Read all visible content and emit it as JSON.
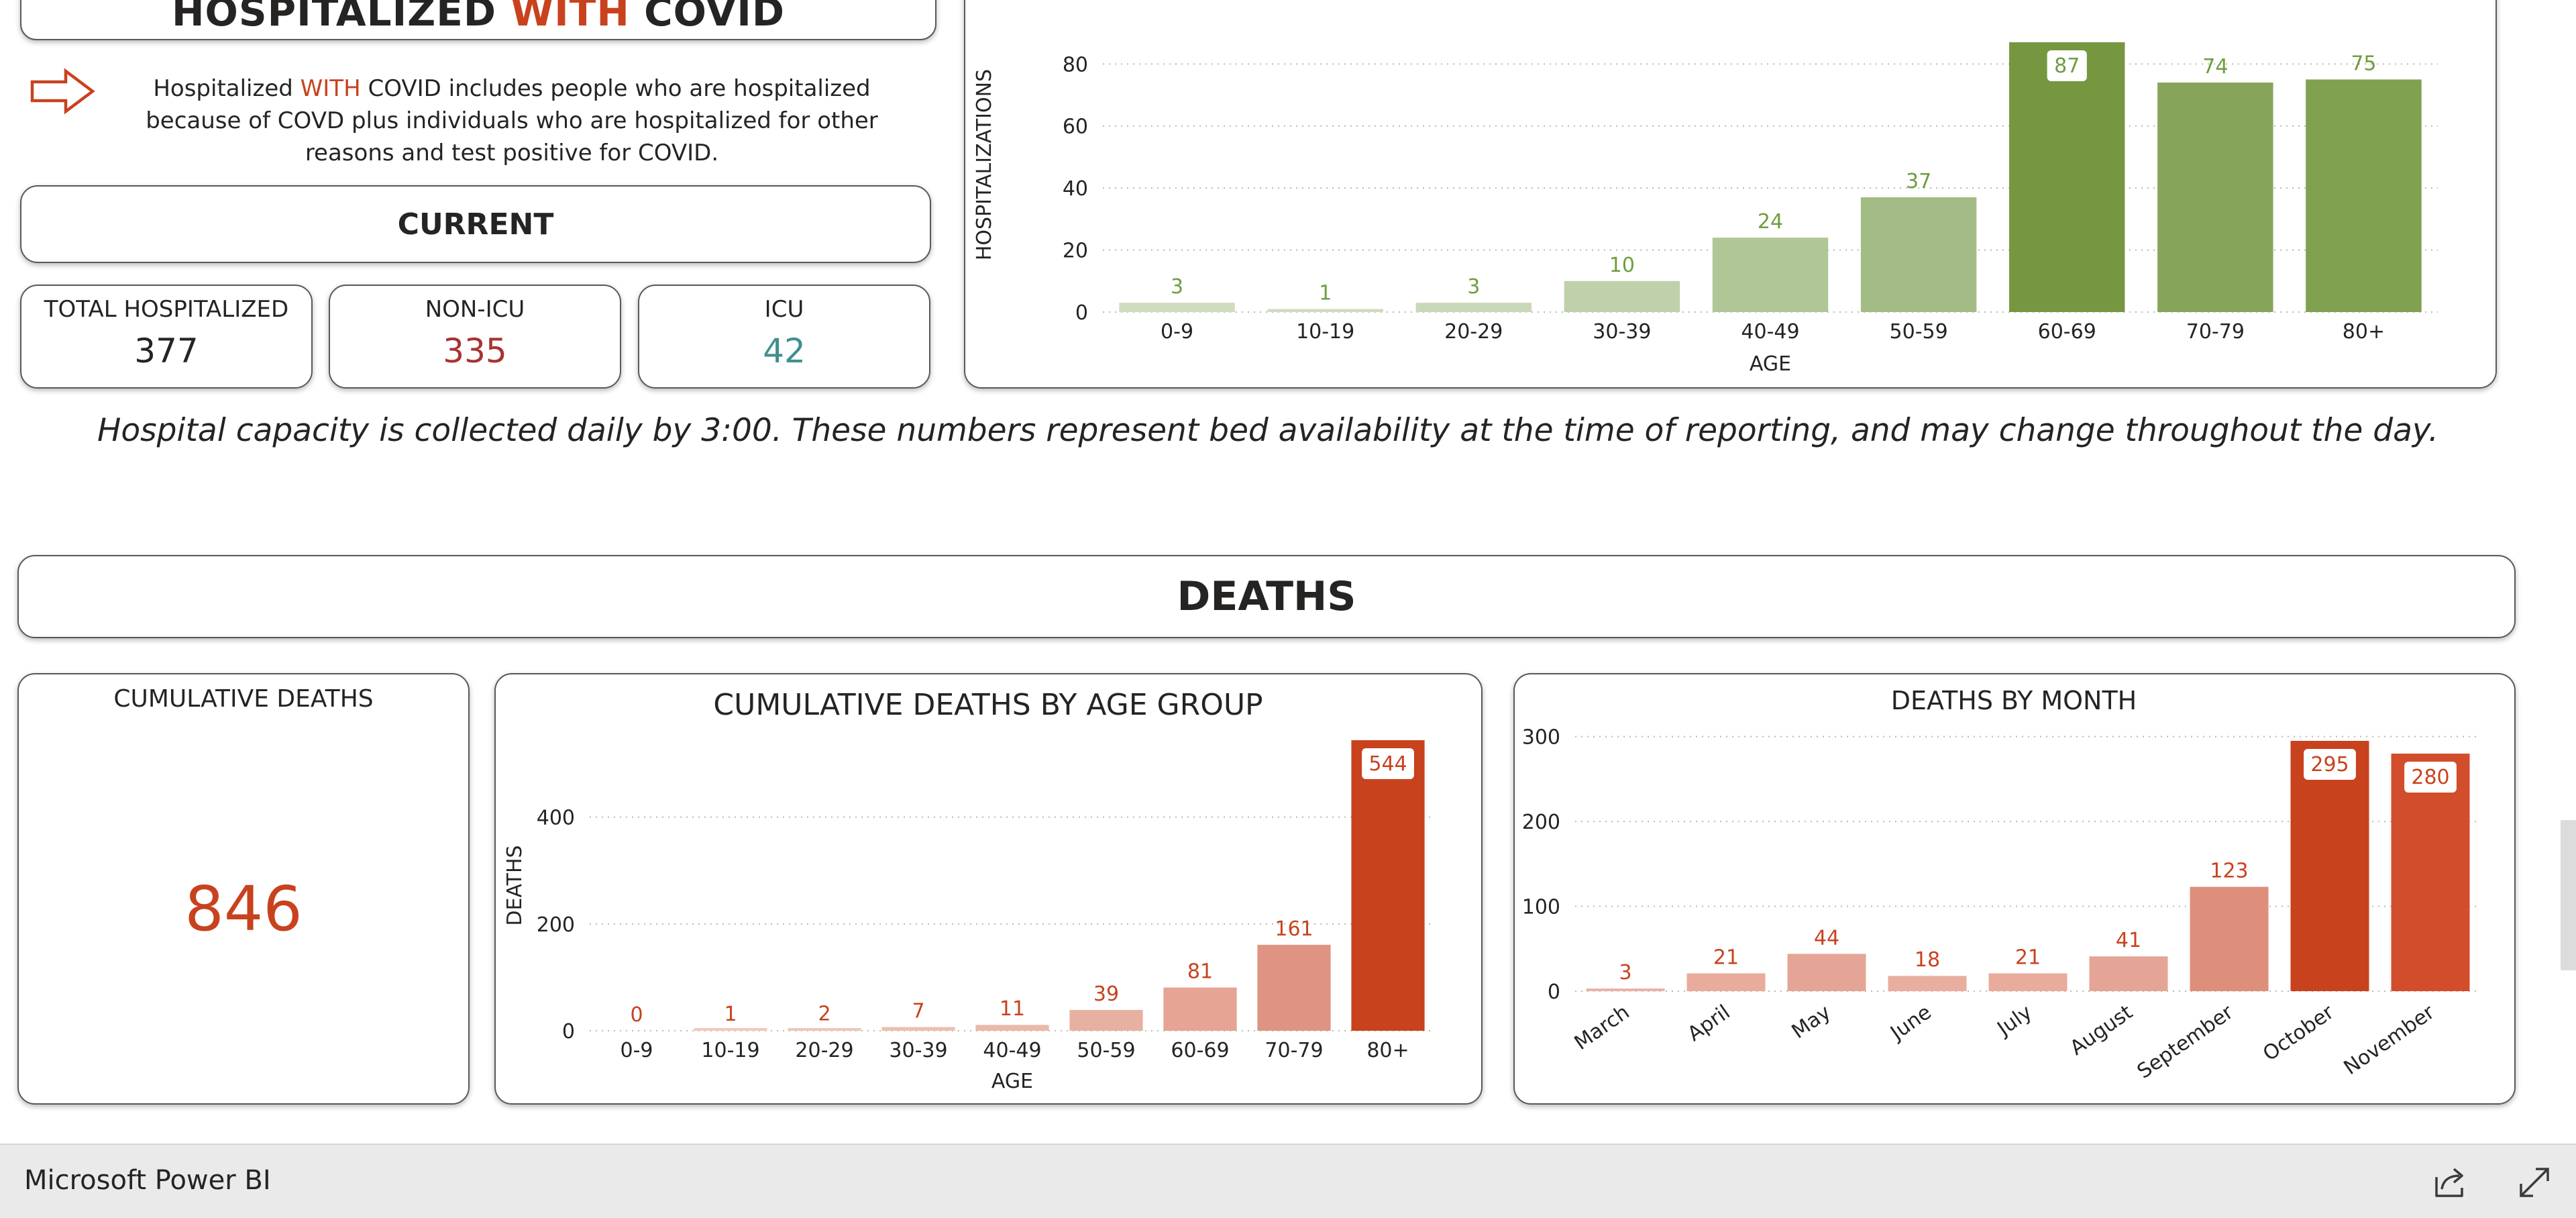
{
  "hosp_header": {
    "part1": "HOSPITALIZED ",
    "part2": "WITH",
    "part3": " COVID"
  },
  "note": {
    "part1": "Hospitalized ",
    "part2": "WITH",
    "part3": " COVID includes people who are hospitalized because of COVD plus individuals who are hospitalized for other reasons and test positive for COVID."
  },
  "current_header": "CURRENT",
  "kpis": {
    "total_hospitalized": {
      "label": "TOTAL HOSPITALIZED",
      "value": "377"
    },
    "non_icu": {
      "label": "NON-ICU",
      "value": "335"
    },
    "icu": {
      "label": "ICU",
      "value": "42"
    }
  },
  "capacity_note": "Hospital capacity is collected daily by 3:00. These numbers represent bed availability at the time of reporting, and may change throughout the day.",
  "deaths_header": "DEATHS",
  "cumulative_deaths": {
    "title": "CUMULATIVE DEATHS",
    "value": "846"
  },
  "footer": {
    "brand": "Microsoft Power BI"
  },
  "colors": {
    "orange": "#c8421e",
    "green_text": "#6f9d40",
    "teal": "#3f8f8f",
    "dark_red": "#a83232"
  },
  "icons": {
    "note": "arrow-right-outline-icon",
    "share": "share-icon",
    "fullscreen": "expand-icon"
  },
  "chart_data": [
    {
      "id": "hospitalizations_by_age",
      "type": "bar",
      "title": "",
      "xlabel": "AGE",
      "ylabel": "HOSPITALIZATIONS",
      "categories": [
        "0-9",
        "10-19",
        "20-29",
        "30-39",
        "40-49",
        "50-59",
        "60-69",
        "70-79",
        "80+"
      ],
      "values": [
        3,
        1,
        3,
        10,
        24,
        37,
        87,
        74,
        75
      ],
      "ylim": [
        0,
        95
      ],
      "yticks": [
        0,
        20,
        40,
        60,
        80
      ],
      "grid": true,
      "colors": [
        "#cfdcc0",
        "#cfdcc0",
        "#cad8ba",
        "#bfd0ab",
        "#b1c697",
        "#a3bc85",
        "#76973f",
        "#86a55a",
        "#7fa150"
      ],
      "label_color": "#6f9d40",
      "boxed_label": "60-69"
    },
    {
      "id": "cumulative_deaths_by_age",
      "type": "bar",
      "title": "CUMULATIVE DEATHS BY AGE GROUP",
      "xlabel": "AGE",
      "ylabel": "DEATHS",
      "categories": [
        "0-9",
        "10-19",
        "20-29",
        "30-39",
        "40-49",
        "50-59",
        "60-69",
        "70-79",
        "80+"
      ],
      "values": [
        0,
        1,
        2,
        7,
        11,
        39,
        81,
        161,
        544
      ],
      "ylim": [
        0,
        544
      ],
      "yticks": [
        0,
        200,
        400
      ],
      "grid": true,
      "colors": [
        "#f0c9bd",
        "#f0c9bd",
        "#efc6b9",
        "#edbfb1",
        "#ebb9a9",
        "#e8b0a0",
        "#e5a494",
        "#df9483",
        "#c8421e"
      ],
      "label_color": "#c8421e",
      "boxed_label": "80+"
    },
    {
      "id": "deaths_by_month",
      "type": "bar",
      "title": "DEATHS BY MONTH",
      "xlabel": "",
      "ylabel": "",
      "categories": [
        "March",
        "April",
        "May",
        "June",
        "July",
        "August",
        "September",
        "October",
        "November"
      ],
      "values": [
        3,
        21,
        44,
        18,
        21,
        41,
        123,
        295,
        280
      ],
      "ylim": [
        0,
        295
      ],
      "yticks": [
        0,
        100,
        200,
        300
      ],
      "grid": true,
      "colors": [
        "#eab3a6",
        "#e8ab9c",
        "#e5a596",
        "#e9ae9f",
        "#e8ab9c",
        "#e5a596",
        "#de8f7c",
        "#c8421e",
        "#d14d2c"
      ],
      "label_color": "#c8421e",
      "boxed_labels": [
        "October",
        "November"
      ]
    }
  ]
}
